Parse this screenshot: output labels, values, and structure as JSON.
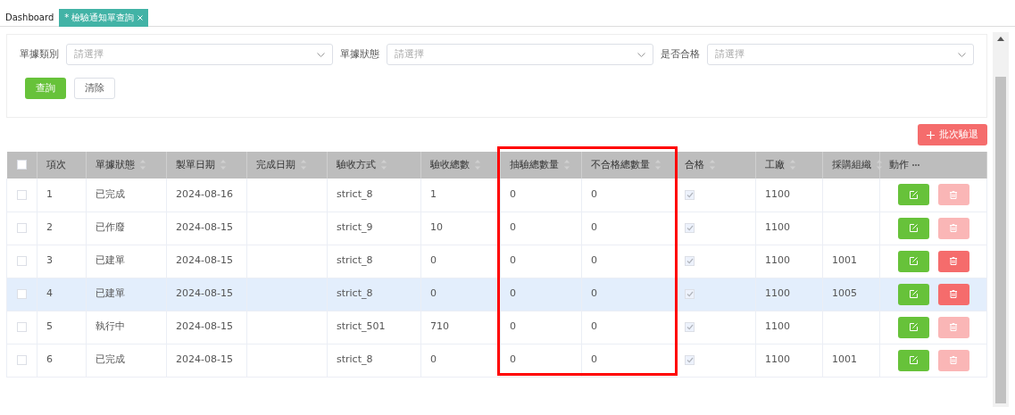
{
  "tabs": [
    {
      "label": "Dashboard",
      "selected": false,
      "closable": false
    },
    {
      "label": "* 檢驗通知單查詢",
      "selected": true,
      "closable": true
    }
  ],
  "filters": [
    {
      "label": "單據類別",
      "placeholder": "請選擇"
    },
    {
      "label": "單據狀態",
      "placeholder": "請選擇"
    },
    {
      "label": "是否合格",
      "placeholder": "請選擇"
    }
  ],
  "buttons": [
    {
      "label": "查詢",
      "kind": "primary"
    },
    {
      "label": "清除",
      "kind": "plain"
    }
  ],
  "batch_button": {
    "label": "批次驗退"
  },
  "table": {
    "select_all": {
      "checked": false
    },
    "columns": [
      {
        "kind": "text",
        "label": "項次",
        "sortable": false
      },
      {
        "kind": "text",
        "label": "單據狀態",
        "sortable": true
      },
      {
        "kind": "text",
        "label": "製單日期",
        "sortable": true
      },
      {
        "kind": "text",
        "label": "完成日期",
        "sortable": true
      },
      {
        "kind": "text",
        "label": "驗收方式",
        "sortable": true
      },
      {
        "kind": "text",
        "label": "驗收總數",
        "sortable": true
      },
      {
        "kind": "text",
        "label": "抽驗總數量",
        "sortable": true,
        "highlighted": true
      },
      {
        "kind": "text",
        "label": "不合格總數量",
        "sortable": true,
        "highlighted": true
      },
      {
        "kind": "checkbox",
        "label": "合格",
        "sortable": true
      },
      {
        "kind": "text",
        "label": "工廠",
        "sortable": true
      },
      {
        "kind": "text",
        "label": "採購組織",
        "sortable": true
      },
      {
        "kind": "actions",
        "label": "動作",
        "sortable": false,
        "menu": true
      }
    ],
    "rows": [
      {
        "selected": false,
        "checked": false,
        "item": "1",
        "status": "已完成",
        "created_on": "2024-08-16",
        "method": "strict_8",
        "received_total": "1",
        "sampled_total": "0",
        "failed_total": "0",
        "qualified": true,
        "plant": "1100",
        "delete_disabled": true
      },
      {
        "selected": false,
        "checked": false,
        "item": "2",
        "status": "已作廢",
        "created_on": "2024-08-15",
        "method": "strict_9",
        "received_total": "10",
        "sampled_total": "0",
        "failed_total": "0",
        "qualified": true,
        "plant": "1100",
        "delete_disabled": true
      },
      {
        "selected": false,
        "checked": false,
        "item": "3",
        "status": "已建單",
        "created_on": "2024-08-15",
        "method": "strict_8",
        "received_total": "0",
        "sampled_total": "0",
        "failed_total": "0",
        "qualified": true,
        "plant": "1100",
        "purchasing_org": "1001",
        "delete_disabled": false
      },
      {
        "selected": true,
        "checked": false,
        "item": "4",
        "status": "已建單",
        "created_on": "2024-08-15",
        "method": "strict_8",
        "received_total": "0",
        "sampled_total": "0",
        "failed_total": "0",
        "qualified": true,
        "plant": "1100",
        "purchasing_org": "1005",
        "delete_disabled": false
      },
      {
        "selected": false,
        "checked": false,
        "item": "5",
        "status": "執行中",
        "created_on": "2024-08-15",
        "method": "strict_501",
        "received_total": "710",
        "sampled_total": "0",
        "failed_total": "0",
        "qualified": true,
        "plant": "1100",
        "delete_disabled": true
      },
      {
        "selected": false,
        "checked": false,
        "item": "6",
        "status": "已完成",
        "created_on": "2024-08-15",
        "method": "strict_8",
        "received_total": "0",
        "sampled_total": "0",
        "failed_total": "0",
        "qualified": true,
        "plant": "1100",
        "purchasing_org": "1001",
        "delete_disabled": true
      }
    ]
  }
}
